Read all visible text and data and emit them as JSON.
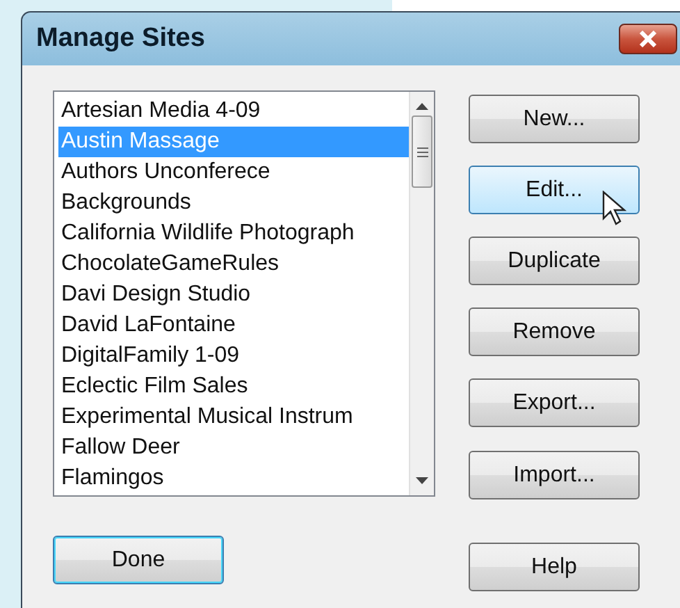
{
  "window": {
    "title": "Manage Sites"
  },
  "sites": [
    {
      "name": "Artesian Media 4-09",
      "selected": false
    },
    {
      "name": "Austin Massage",
      "selected": true
    },
    {
      "name": "Authors Unconferece",
      "selected": false
    },
    {
      "name": "Backgrounds",
      "selected": false
    },
    {
      "name": "California Wildlife Photograph",
      "selected": false
    },
    {
      "name": "ChocolateGameRules",
      "selected": false
    },
    {
      "name": "Davi Design Studio",
      "selected": false
    },
    {
      "name": "David LaFontaine",
      "selected": false
    },
    {
      "name": "DigitalFamily 1-09",
      "selected": false
    },
    {
      "name": "Eclectic Film Sales",
      "selected": false
    },
    {
      "name": "Experimental Musical Instrum",
      "selected": false
    },
    {
      "name": "Fallow Deer",
      "selected": false
    },
    {
      "name": "Flamingos",
      "selected": false
    }
  ],
  "side_buttons": [
    {
      "label": "New...",
      "hovered": false
    },
    {
      "label": "Edit...",
      "hovered": true
    },
    {
      "label": "Duplicate",
      "hovered": false
    },
    {
      "label": "Remove",
      "hovered": false
    },
    {
      "label": "Export...",
      "hovered": false
    },
    {
      "label": "Import...",
      "hovered": false
    }
  ],
  "done_button": {
    "label": "Done",
    "default": true
  },
  "help_button": {
    "label": "Help",
    "default": false
  }
}
